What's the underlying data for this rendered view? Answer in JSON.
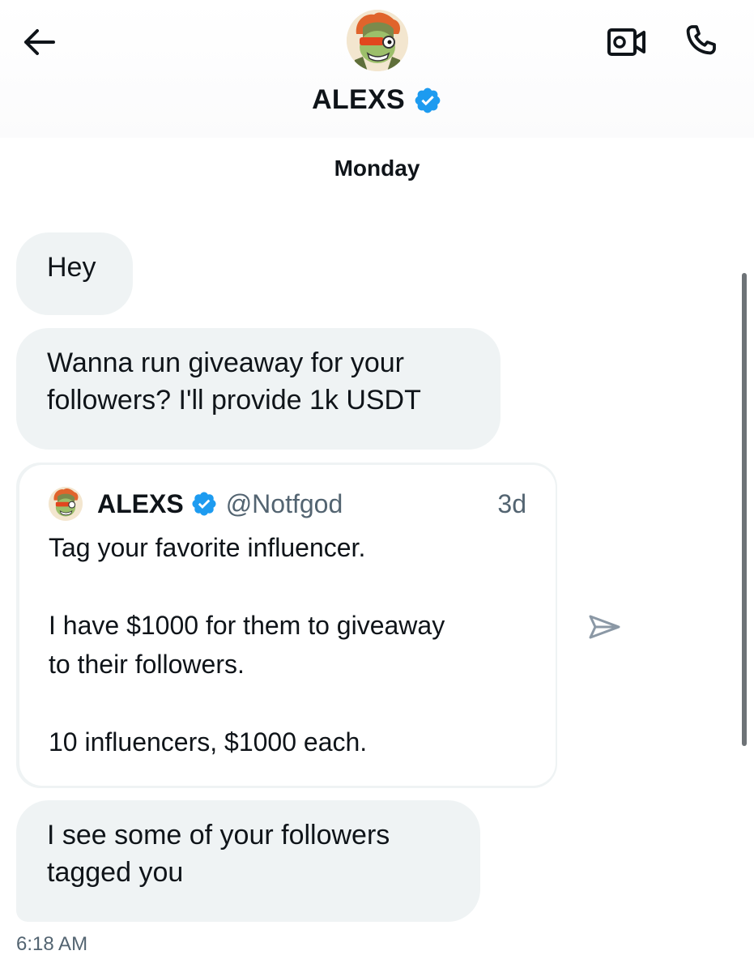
{
  "header": {
    "name": "ALEXS",
    "back_icon": "arrow-left-icon",
    "video_icon": "video-call-icon",
    "call_icon": "phone-icon",
    "verified_icon": "verified-badge-icon"
  },
  "conversation": {
    "day_label": "Monday",
    "messages": [
      {
        "text": "Hey"
      },
      {
        "line1": "Wanna run giveaway for your",
        "line2": "followers? I'll provide 1k USDT"
      },
      {
        "line1": "I see some of your followers",
        "line2": "tagged you"
      }
    ],
    "quoted_post": {
      "name": "ALEXS",
      "handle": "@Notfgod",
      "time": "3d",
      "line1": "Tag your favorite influencer.",
      "line2": "I have $1000 for them to giveaway",
      "line3": "to their followers.",
      "line4": "10 influencers, $1000 each."
    },
    "timestamp": "6:18 AM",
    "share_icon": "send-icon"
  },
  "colors": {
    "bubble": "#eff3f4",
    "verified": "#1d9bf0",
    "muted_text": "#536471",
    "text": "#0f1419"
  }
}
